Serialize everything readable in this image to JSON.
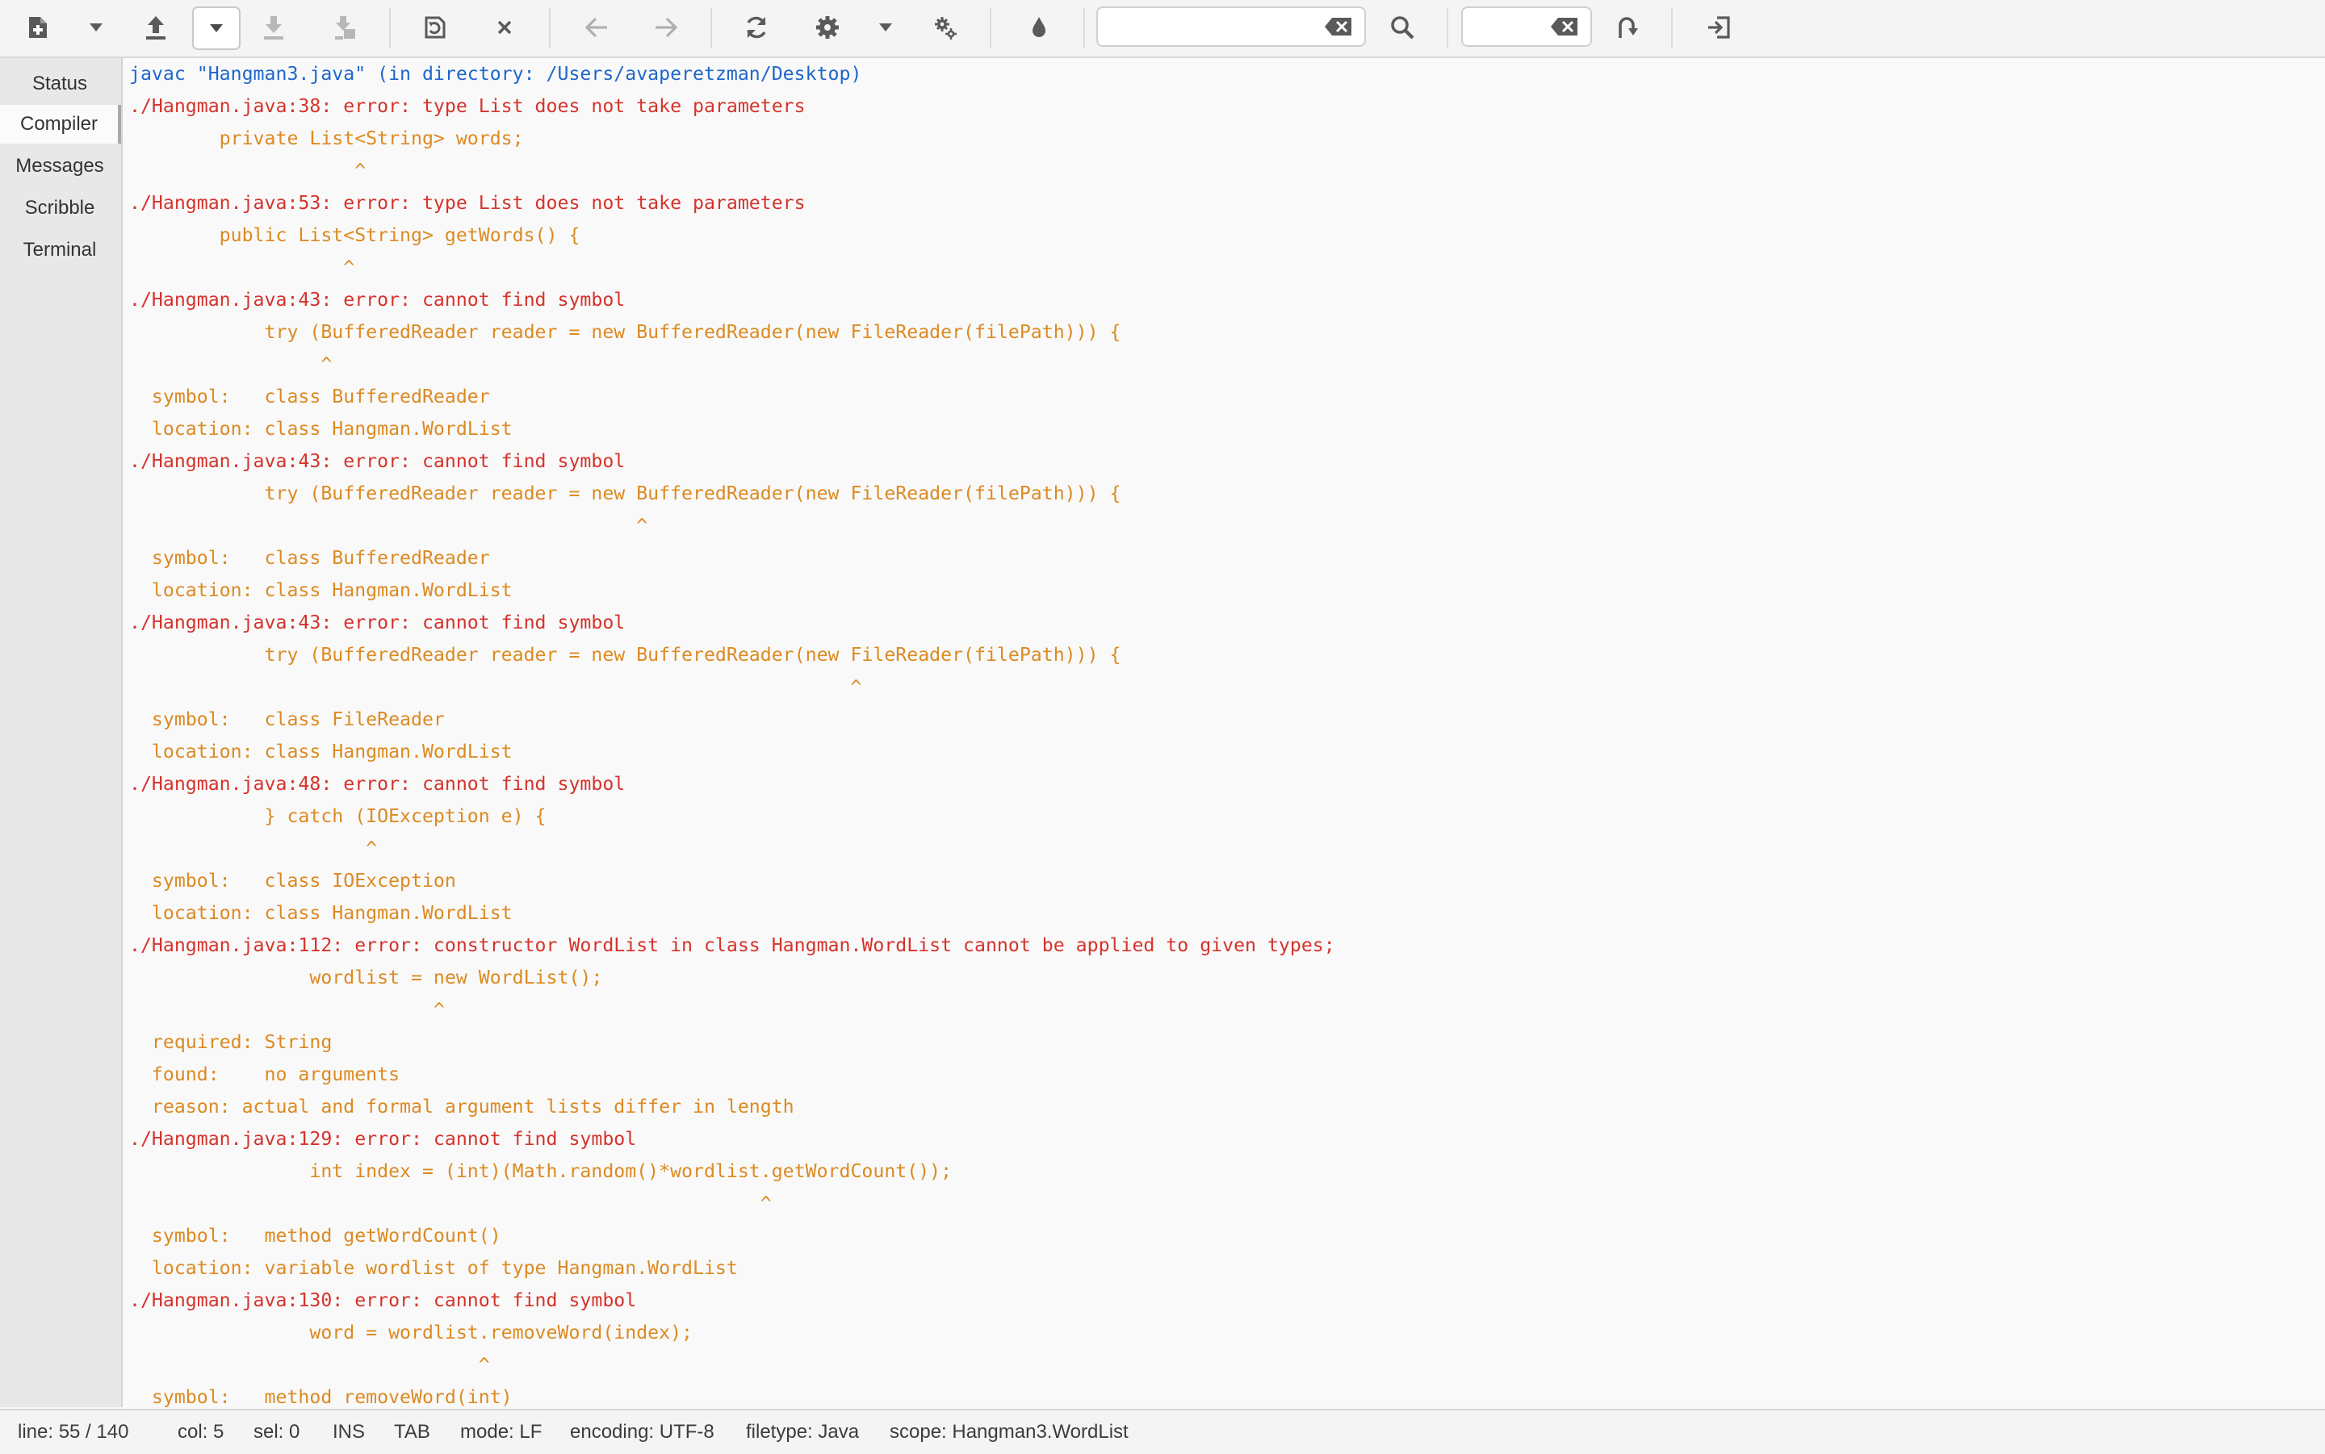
{
  "toolbar": {
    "buttons": [
      {
        "name": "new-file-icon"
      },
      {
        "name": "new-file-dropdown-icon"
      },
      {
        "name": "open-file-icon"
      },
      {
        "name": "open-dropdown-icon"
      },
      {
        "name": "save-icon"
      },
      {
        "name": "save-all-icon"
      },
      {
        "name": "revert-icon"
      },
      {
        "name": "close-icon"
      },
      {
        "name": "back-arrow-icon"
      },
      {
        "name": "forward-arrow-icon"
      },
      {
        "name": "reload-icon"
      },
      {
        "name": "build-gear-icon"
      },
      {
        "name": "build-dropdown-icon"
      },
      {
        "name": "execute-gears-icon"
      },
      {
        "name": "color-drop-icon"
      },
      {
        "name": "search-icon"
      },
      {
        "name": "jump-to-line-icon"
      },
      {
        "name": "quit-icon"
      }
    ],
    "search": {
      "value": "",
      "placeholder": ""
    },
    "goto_line": {
      "value": "",
      "placeholder": ""
    }
  },
  "sidebar": {
    "tabs": [
      {
        "label": "Status",
        "active": false
      },
      {
        "label": "Compiler",
        "active": true
      },
      {
        "label": "Messages",
        "active": false
      },
      {
        "label": "Scribble",
        "active": false
      },
      {
        "label": "Terminal",
        "active": false
      }
    ]
  },
  "compiler": {
    "lines": [
      {
        "text": "javac \"Hangman3.java\" (in directory: /Users/avaperetzman/Desktop)",
        "kind": "cmd"
      },
      {
        "text": "./Hangman.java:38: error: type List does not take parameters",
        "kind": "err"
      },
      {
        "text": "        private List<String> words;",
        "kind": "warn"
      },
      {
        "text": "                    ^",
        "kind": "warn"
      },
      {
        "text": "./Hangman.java:53: error: type List does not take parameters",
        "kind": "err"
      },
      {
        "text": "        public List<String> getWords() {",
        "kind": "warn"
      },
      {
        "text": "                   ^",
        "kind": "warn"
      },
      {
        "text": "./Hangman.java:43: error: cannot find symbol",
        "kind": "err"
      },
      {
        "text": "            try (BufferedReader reader = new BufferedReader(new FileReader(filePath))) {",
        "kind": "warn"
      },
      {
        "text": "                 ^",
        "kind": "warn"
      },
      {
        "text": "  symbol:   class BufferedReader",
        "kind": "warn"
      },
      {
        "text": "  location: class Hangman.WordList",
        "kind": "warn"
      },
      {
        "text": "./Hangman.java:43: error: cannot find symbol",
        "kind": "err"
      },
      {
        "text": "            try (BufferedReader reader = new BufferedReader(new FileReader(filePath))) {",
        "kind": "warn"
      },
      {
        "text": "                                             ^",
        "kind": "warn"
      },
      {
        "text": "  symbol:   class BufferedReader",
        "kind": "warn"
      },
      {
        "text": "  location: class Hangman.WordList",
        "kind": "warn"
      },
      {
        "text": "./Hangman.java:43: error: cannot find symbol",
        "kind": "err"
      },
      {
        "text": "            try (BufferedReader reader = new BufferedReader(new FileReader(filePath))) {",
        "kind": "warn"
      },
      {
        "text": "                                                                ^",
        "kind": "warn"
      },
      {
        "text": "  symbol:   class FileReader",
        "kind": "warn"
      },
      {
        "text": "  location: class Hangman.WordList",
        "kind": "warn"
      },
      {
        "text": "./Hangman.java:48: error: cannot find symbol",
        "kind": "err"
      },
      {
        "text": "            } catch (IOException e) {",
        "kind": "warn"
      },
      {
        "text": "                     ^",
        "kind": "warn"
      },
      {
        "text": "  symbol:   class IOException",
        "kind": "warn"
      },
      {
        "text": "  location: class Hangman.WordList",
        "kind": "warn"
      },
      {
        "text": "./Hangman.java:112: error: constructor WordList in class Hangman.WordList cannot be applied to given types;",
        "kind": "err"
      },
      {
        "text": "                wordlist = new WordList();",
        "kind": "warn"
      },
      {
        "text": "                           ^",
        "kind": "warn"
      },
      {
        "text": "  required: String",
        "kind": "warn"
      },
      {
        "text": "  found:    no arguments",
        "kind": "warn"
      },
      {
        "text": "  reason: actual and formal argument lists differ in length",
        "kind": "warn"
      },
      {
        "text": "./Hangman.java:129: error: cannot find symbol",
        "kind": "err"
      },
      {
        "text": "                int index = (int)(Math.random()*wordlist.getWordCount());",
        "kind": "warn"
      },
      {
        "text": "                                                        ^",
        "kind": "warn"
      },
      {
        "text": "  symbol:   method getWordCount()",
        "kind": "warn"
      },
      {
        "text": "  location: variable wordlist of type Hangman.WordList",
        "kind": "warn"
      },
      {
        "text": "./Hangman.java:130: error: cannot find symbol",
        "kind": "err"
      },
      {
        "text": "                word = wordlist.removeWord(index);",
        "kind": "warn"
      },
      {
        "text": "                               ^",
        "kind": "warn"
      },
      {
        "text": "  symbol:   method removeWord(int)",
        "kind": "warn"
      }
    ]
  },
  "statusbar": {
    "line": "line: 55 / 140",
    "col": "col: 5",
    "sel": "sel: 0",
    "ins": "INS",
    "tab": "TAB",
    "mode": "mode: LF",
    "encoding": "encoding: UTF-8",
    "filetype": "filetype: Java",
    "scope": "scope: Hangman3.WordList"
  },
  "colors": {
    "cmd": "#1f66cc",
    "error": "#d5332c",
    "detail": "#dc8a22"
  }
}
